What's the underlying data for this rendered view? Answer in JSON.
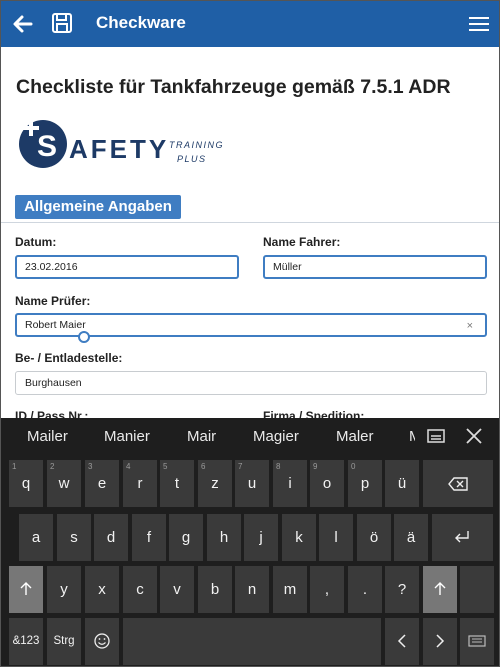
{
  "appbar": {
    "title": "Checkware",
    "back_icon": "back-arrow-icon",
    "save_icon": "save-icon",
    "menu_icon": "hamburger-menu-icon"
  },
  "page": {
    "title": "Checkliste für Tankfahrzeuge gemäß 7.5.1 ADR"
  },
  "logo": {
    "main_text": "SAFETY",
    "sub_line1": "TRAINING",
    "sub_line2": "PLUS",
    "brand_color": "#1d3a66"
  },
  "section": {
    "label": "Allgemeine Angaben",
    "color": "#3f7dc2"
  },
  "form": {
    "datum": {
      "label": "Datum:",
      "value": "23.02.2016"
    },
    "fahrer": {
      "label": "Name Fahrer:",
      "value": "Müller"
    },
    "pruefer": {
      "label": "Name Prüfer:",
      "value": "Robert Maier",
      "clear": "×"
    },
    "stelle": {
      "label": "Be- / Entladestelle:",
      "value": "Burghausen"
    },
    "pass": {
      "label": "ID / Pass Nr.:"
    },
    "firma": {
      "label": "Firma / Spedition:"
    }
  },
  "keyboard": {
    "suggestions": [
      "Mailer",
      "Manier",
      "Mair",
      "Magier",
      "Maler",
      "Ma"
    ],
    "row1": [
      {
        "key": "q",
        "num": "1"
      },
      {
        "key": "w",
        "num": "2"
      },
      {
        "key": "e",
        "num": "3"
      },
      {
        "key": "r",
        "num": "4"
      },
      {
        "key": "t",
        "num": "5"
      },
      {
        "key": "z",
        "num": "6"
      },
      {
        "key": "u",
        "num": "7"
      },
      {
        "key": "i",
        "num": "8"
      },
      {
        "key": "o",
        "num": "9"
      },
      {
        "key": "p",
        "num": "0"
      },
      {
        "key": "ü",
        "num": ""
      }
    ],
    "row2": [
      "a",
      "s",
      "d",
      "f",
      "g",
      "h",
      "j",
      "k",
      "l",
      "ö",
      "ä"
    ],
    "row3": [
      "y",
      "x",
      "c",
      "v",
      "b",
      "n",
      "m",
      ",",
      ".",
      "?"
    ],
    "symbols_label": "&123",
    "ctrl_label": "Strg"
  }
}
